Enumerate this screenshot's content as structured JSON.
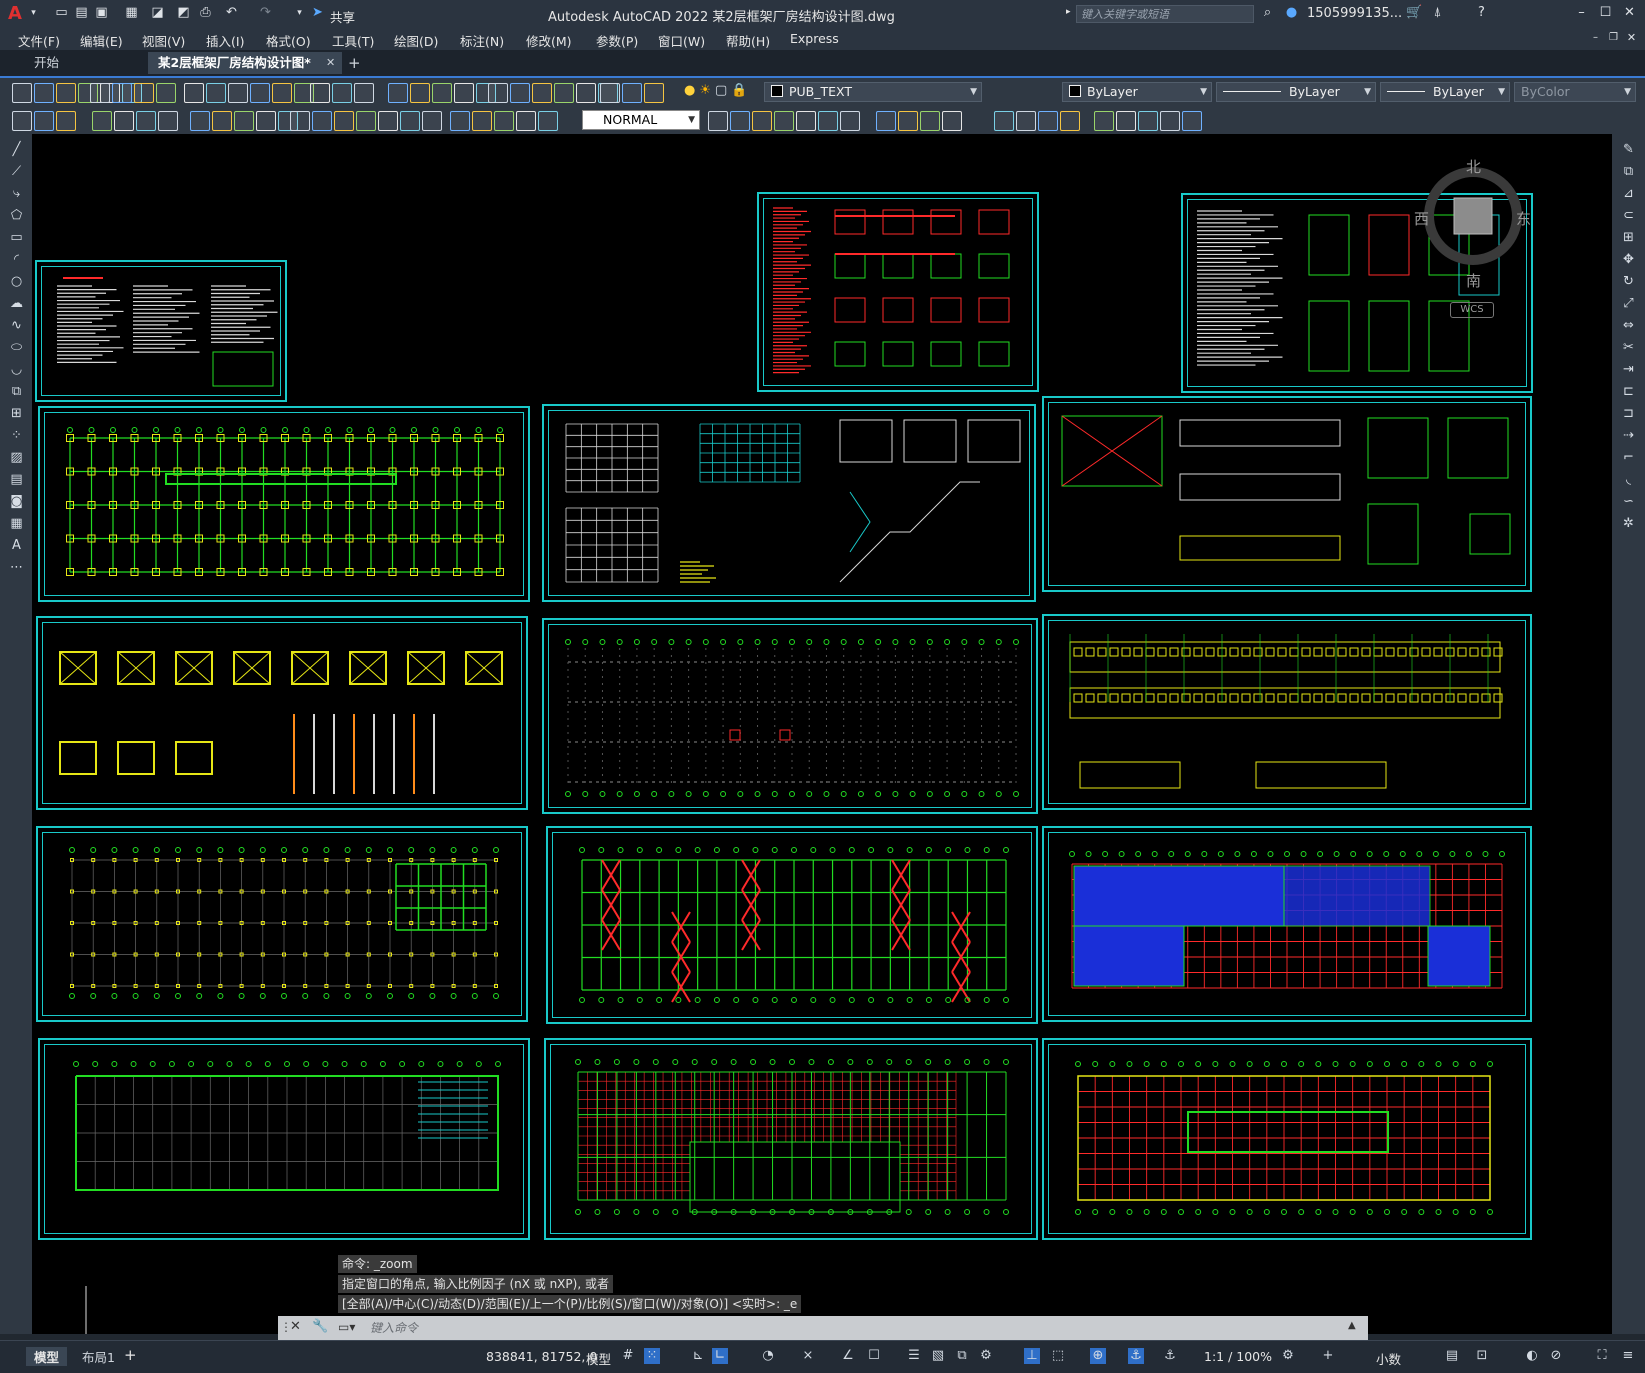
{
  "app": {
    "title": "Autodesk AutoCAD 2022    某2层框架厂房结构设计图.dwg",
    "search_placeholder": "键入关键字或短语",
    "user": "1505999135...",
    "share_label": "共享"
  },
  "menu": [
    "文件(F)",
    "编辑(E)",
    "视图(V)",
    "插入(I)",
    "格式(O)",
    "工具(T)",
    "绘图(D)",
    "标注(N)",
    "修改(M)",
    "参数(P)",
    "窗口(W)",
    "帮助(H)",
    "Express"
  ],
  "tabs": [
    {
      "label": "开始",
      "active": false
    },
    {
      "label": "某2层框架厂房结构设计图*",
      "active": true
    }
  ],
  "properties": {
    "layer": "PUB_TEXT",
    "color": "ByLayer",
    "linetype": "ByLayer",
    "lineweight": "ByLayer",
    "plotstyle": "ByColor",
    "dimstyle": "NORMAL"
  },
  "viewcube": {
    "north": "北",
    "south": "南",
    "east": "东",
    "west": "西",
    "wcs": "WCS"
  },
  "command": {
    "history": [
      "命令:         _zoom",
      "指定窗口的角点, 输入比例因子 (nX 或 nXP), 或者",
      "[全部(A)/中心(C)/动态(D)/范围(E)/上一个(P)/比例(S)/窗口(W)/对象(O)] <实时>: _e"
    ],
    "placeholder": "键入命令"
  },
  "layout_tabs": [
    "模型",
    "布局1"
  ],
  "status": {
    "coordinates": "838841, 81752, 0",
    "space": "模型",
    "scale": "1:1 / 100%",
    "units": "小数"
  },
  "colors": {
    "background": "#000000",
    "sheet_border": "#19c9c9",
    "grid_green": "#22dd22",
    "dim_red": "#ff2a2a",
    "hatch_blue": "#1a2fd8",
    "yellow": "#e6e615"
  }
}
